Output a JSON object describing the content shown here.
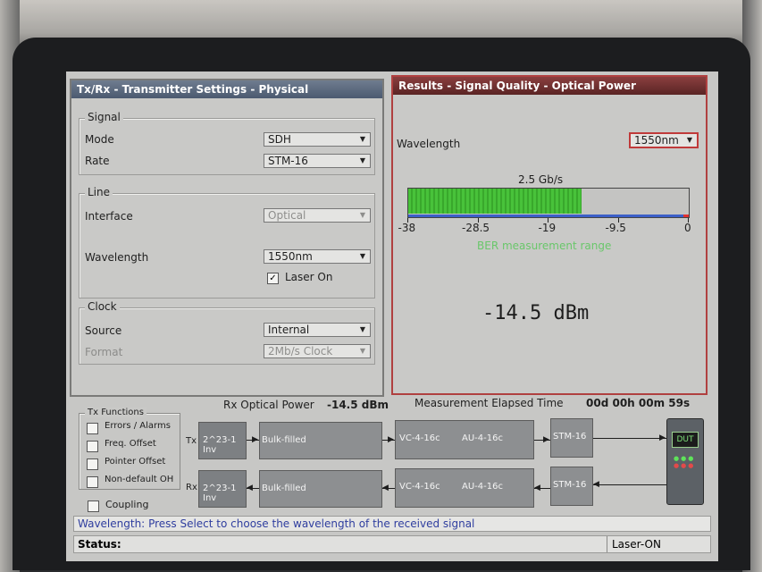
{
  "left_panel": {
    "title": "Tx/Rx - Transmitter Settings - Physical",
    "signal": {
      "group_label": "Signal",
      "mode_label": "Mode",
      "mode_value": "SDH",
      "rate_label": "Rate",
      "rate_value": "STM-16"
    },
    "line": {
      "group_label": "Line",
      "interface_label": "Interface",
      "interface_value": "Optical",
      "wavelength_label": "Wavelength",
      "wavelength_value": "1550nm",
      "laser_on_label": "Laser On",
      "laser_on_checked": true
    },
    "clock": {
      "group_label": "Clock",
      "source_label": "Source",
      "source_value": "Internal",
      "format_label": "Format",
      "format_value": "2Mb/s Clock"
    }
  },
  "right_panel": {
    "title": "Results - Signal Quality - Optical Power",
    "wavelength_label": "Wavelength",
    "wavelength_value": "1550nm",
    "rate_label": "2.5 Gb/s",
    "gauge": {
      "min": -38,
      "max": 0,
      "value": -14.5,
      "tick_labels": [
        "-38",
        "-28.5",
        "-19",
        "-9.5",
        "0"
      ],
      "ber_range_label": "BER measurement range"
    },
    "power_value": "-14.5 dBm"
  },
  "bottom": {
    "rx_power_label": "Rx Optical Power",
    "rx_power_value": "-14.5  dBm",
    "elapsed_label": "Measurement Elapsed Time",
    "elapsed_value": "00d 00h 00m 59s",
    "tx_functions": {
      "group_label": "Tx Functions",
      "items": [
        "Errors / Alarms",
        "Freq. Offset",
        "Pointer Offset",
        "Non-default OH"
      ],
      "coupling_label": "Coupling"
    },
    "diagram": {
      "tx_label": "Tx",
      "rx_label": "Rx",
      "pattern_label": "2^23-1 Inv",
      "payload_label": "Bulk-filled",
      "vc_label": "VC-4-16c",
      "au_label": "AU-4-16c",
      "stm_label": "STM-16",
      "dut_label": "DUT"
    }
  },
  "hint": {
    "prefix": "Wavelength:",
    "text": "Press Select to choose the wavelength of the received signal"
  },
  "status": {
    "label": "Status:",
    "laser_state": "Laser-ON"
  },
  "colors": {
    "accent_green": "#48c23a",
    "gauge_blue": "#3b5fc8",
    "gauge_red": "#e03131",
    "active_panel_border": "#b04040"
  }
}
